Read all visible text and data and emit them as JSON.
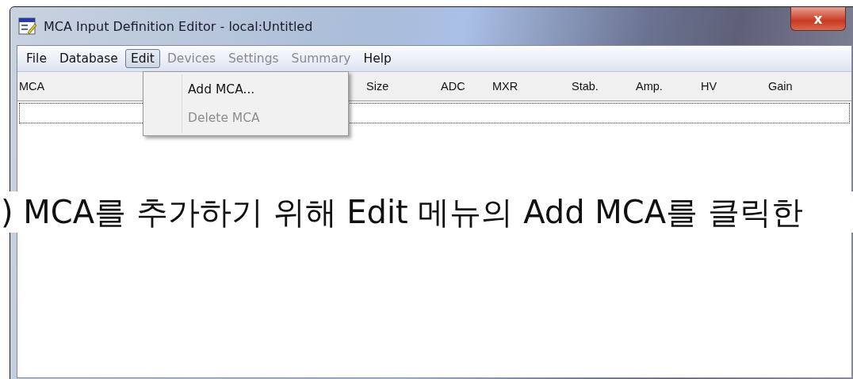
{
  "window": {
    "title": "MCA Input Definition Editor - local:Untitled",
    "close": "x"
  },
  "menu_bar": [
    {
      "label": "File",
      "selected": false,
      "disabled": false
    },
    {
      "label": "Database",
      "selected": false,
      "disabled": false
    },
    {
      "label": "Edit",
      "selected": true,
      "disabled": false
    },
    {
      "label": "Devices",
      "selected": false,
      "disabled": true
    },
    {
      "label": "Settings",
      "selected": false,
      "disabled": true
    },
    {
      "label": "Summary",
      "selected": false,
      "disabled": true
    },
    {
      "label": "Help",
      "selected": false,
      "disabled": false
    }
  ],
  "edit_menu": [
    {
      "label": "Add MCA...",
      "disabled": false
    },
    {
      "label": "Delete MCA",
      "disabled": true
    }
  ],
  "table": {
    "columns": [
      "MCA",
      "Size",
      "ADC",
      "MXR",
      "Stab.",
      "Amp.",
      "HV",
      "Gain"
    ]
  },
  "caption": ") MCA를 추가하기 위해 Edit 메뉴의 Add MCA를 클릭한"
}
